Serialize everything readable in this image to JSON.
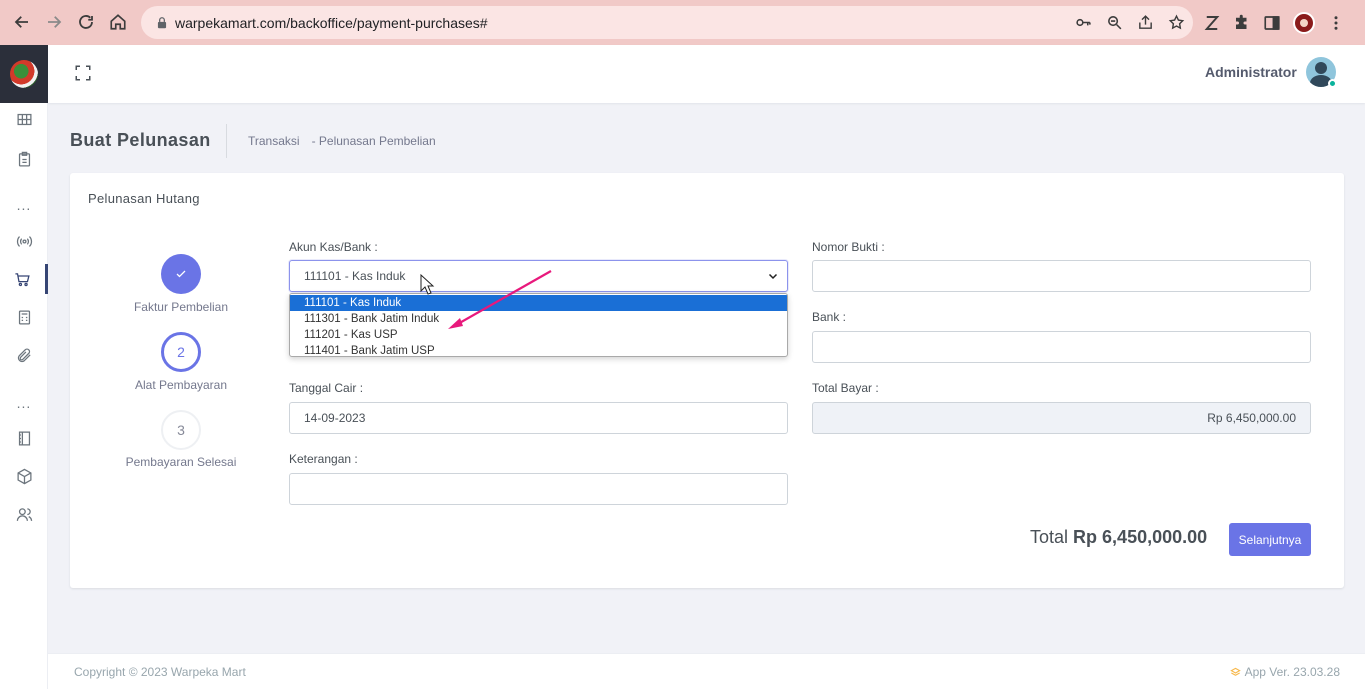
{
  "browser": {
    "url": "warpekamart.com/backoffice/payment-purchases#"
  },
  "header": {
    "user_name": "Administrator"
  },
  "page": {
    "title": "Buat Pelunasan",
    "breadcrumb": [
      "Transaksi",
      "-  Pelunasan Pembelian"
    ]
  },
  "card": {
    "title": "Pelunasan Hutang"
  },
  "stepper": {
    "steps": [
      {
        "number": "✓",
        "label": "Faktur Pembelian"
      },
      {
        "number": "2",
        "label": "Alat Pembayaran"
      },
      {
        "number": "3",
        "label": "Pembayaran Selesai"
      }
    ]
  },
  "form": {
    "akun_label": "Akun Kas/Bank :",
    "akun_value": "111101 - Kas Induk",
    "akun_options": [
      "111101 - Kas Induk",
      "111301 - Bank Jatim Induk",
      "111201 - Kas USP",
      "111401 - Bank Jatim USP"
    ],
    "nomor_bukti_label": "Nomor Bukti :",
    "nomor_bukti_value": "",
    "bank_label": "Bank :",
    "bank_value": "",
    "tanggal_cair_label": "Tanggal Cair :",
    "tanggal_cair_value": "14-09-2023",
    "total_bayar_label": "Total Bayar :",
    "total_bayar_value": "Rp 6,450,000.00",
    "keterangan_label": "Keterangan :",
    "keterangan_value": ""
  },
  "summary": {
    "total_label": "Total",
    "total_value": "Rp 6,450,000.00",
    "next_label": "Selanjutnya"
  },
  "footer": {
    "copyright": "Copyright © 2023 Warpeka Mart",
    "version": "App Ver. 23.03.28"
  },
  "colors": {
    "primary": "#6a74e6",
    "browser_chrome": "#f1c9c7",
    "annotation_arrow": "#e8197c",
    "selected_option": "#1a6fd6"
  }
}
